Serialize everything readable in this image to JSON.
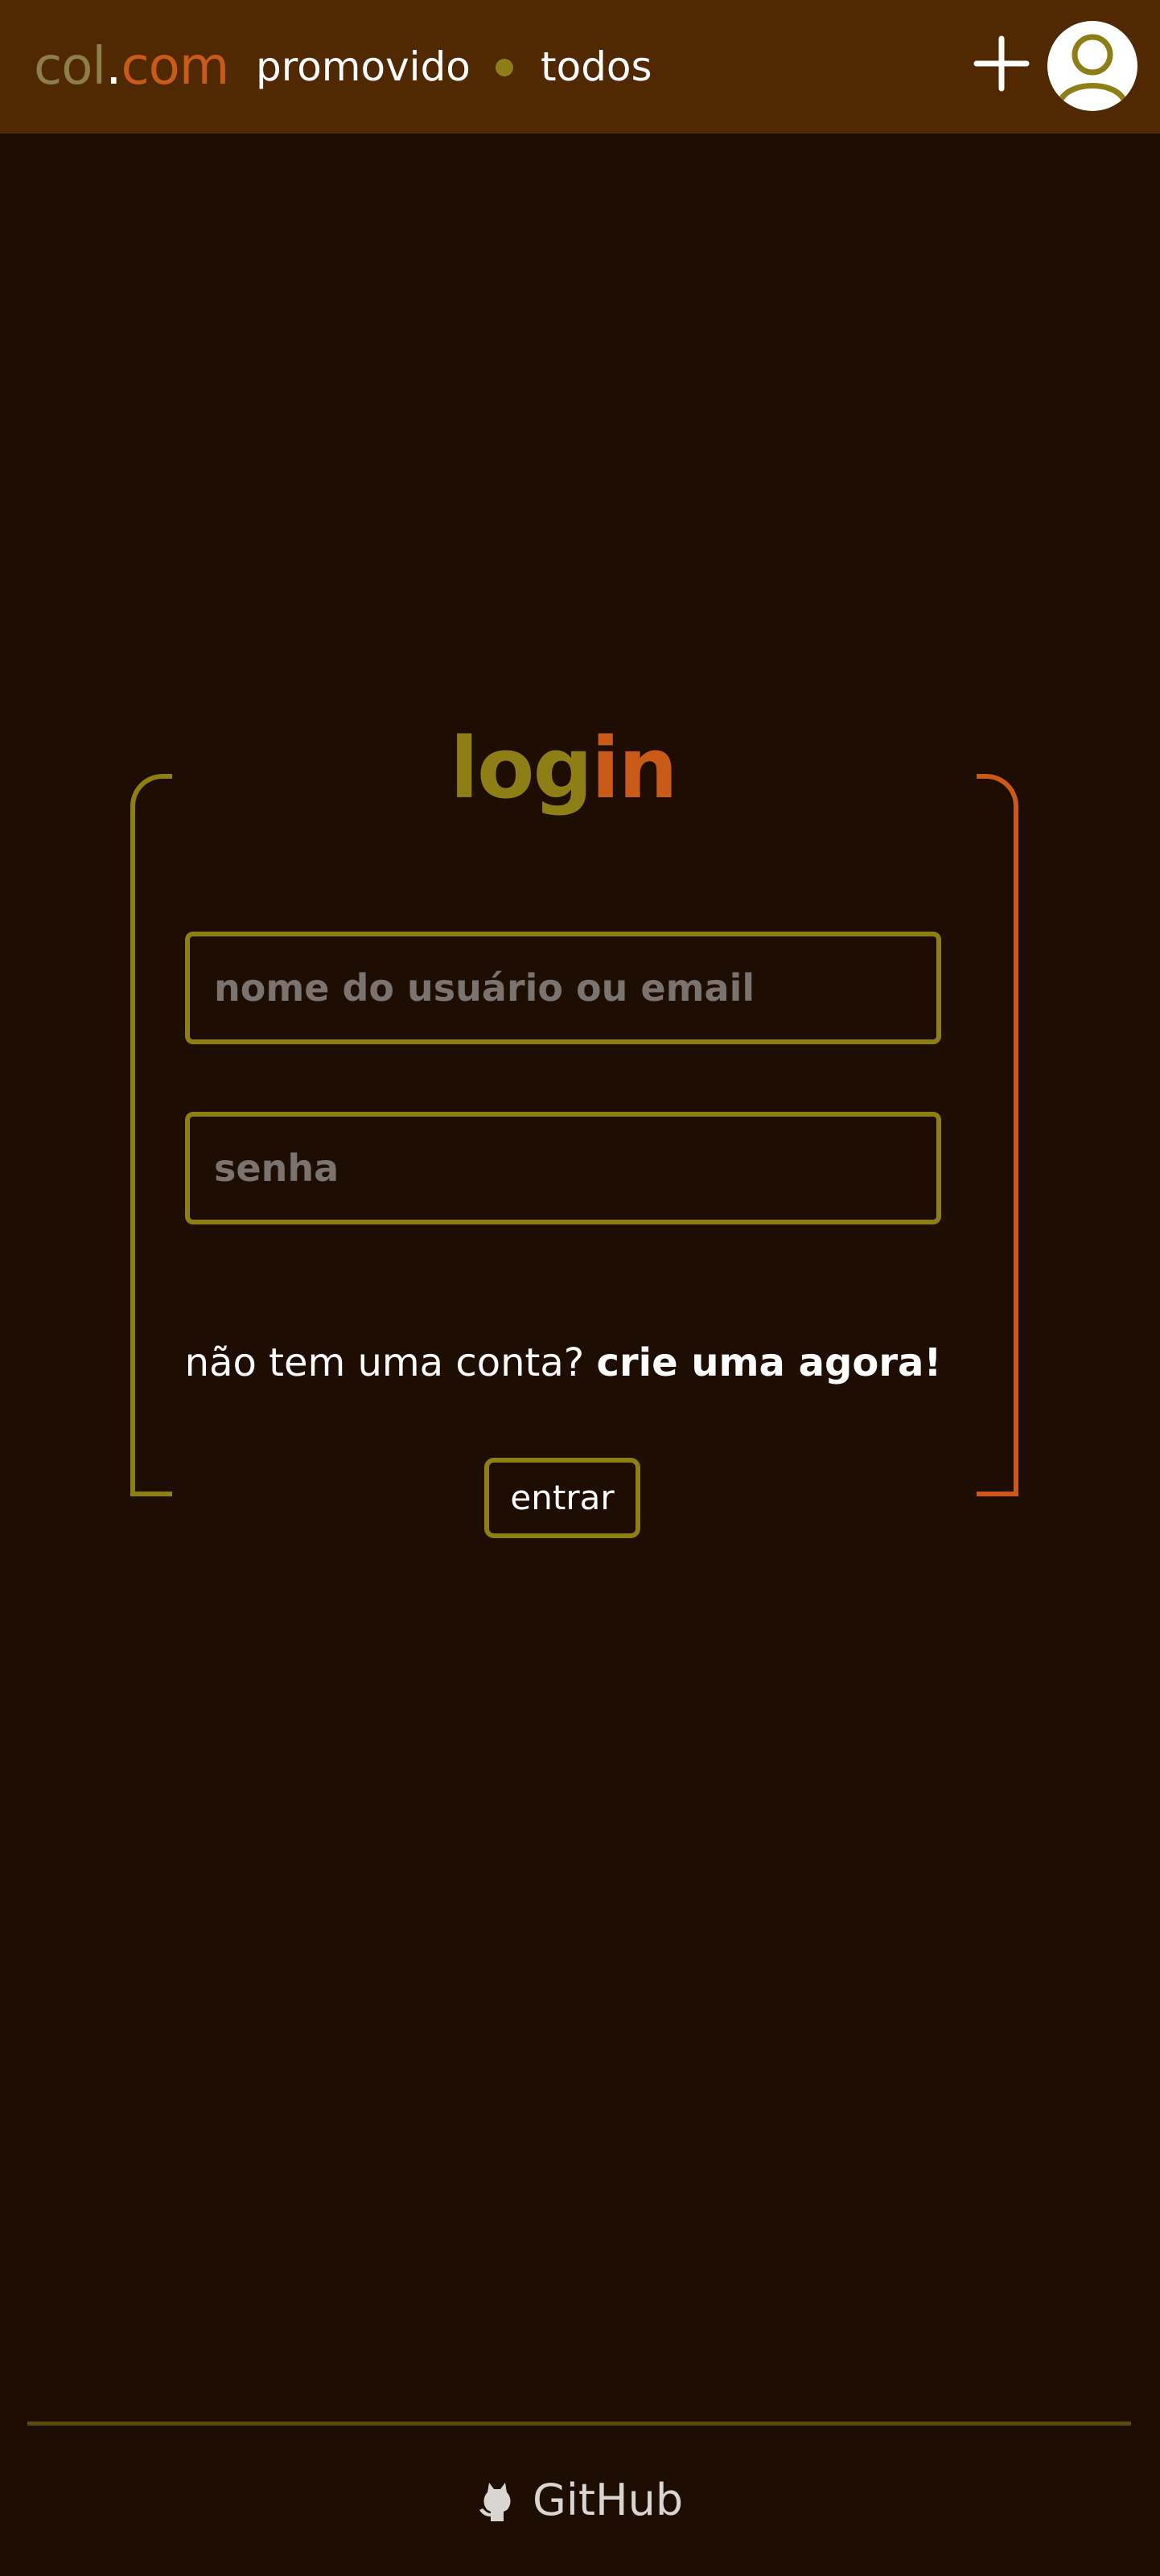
{
  "header": {
    "brand": {
      "part1": "col",
      "part2": ".",
      "part3": "com"
    },
    "nav": {
      "promoted": "promovido",
      "separator_icon": "dot-icon",
      "all": "todos"
    },
    "actions": {
      "add_icon": "plus-icon",
      "avatar_icon": "user-icon"
    }
  },
  "login": {
    "title_a": "log",
    "title_b": "in",
    "username_placeholder": "nome do usuário ou email",
    "username_value": "",
    "password_placeholder": "senha",
    "password_value": "",
    "signup_prompt": "não tem uma conta?",
    "signup_link": "crie uma agora!",
    "submit_label": "entrar"
  },
  "footer": {
    "github_icon": "github-octocat-icon",
    "github_label": "GitHub"
  },
  "colors": {
    "background": "#1e0d03",
    "header_bg": "#502903",
    "accent_olive": "#8d7e15",
    "accent_orange": "#c95a18",
    "brand_muted": "#8e7f4a",
    "placeholder": "#7a7370",
    "text": "#ffffff"
  }
}
